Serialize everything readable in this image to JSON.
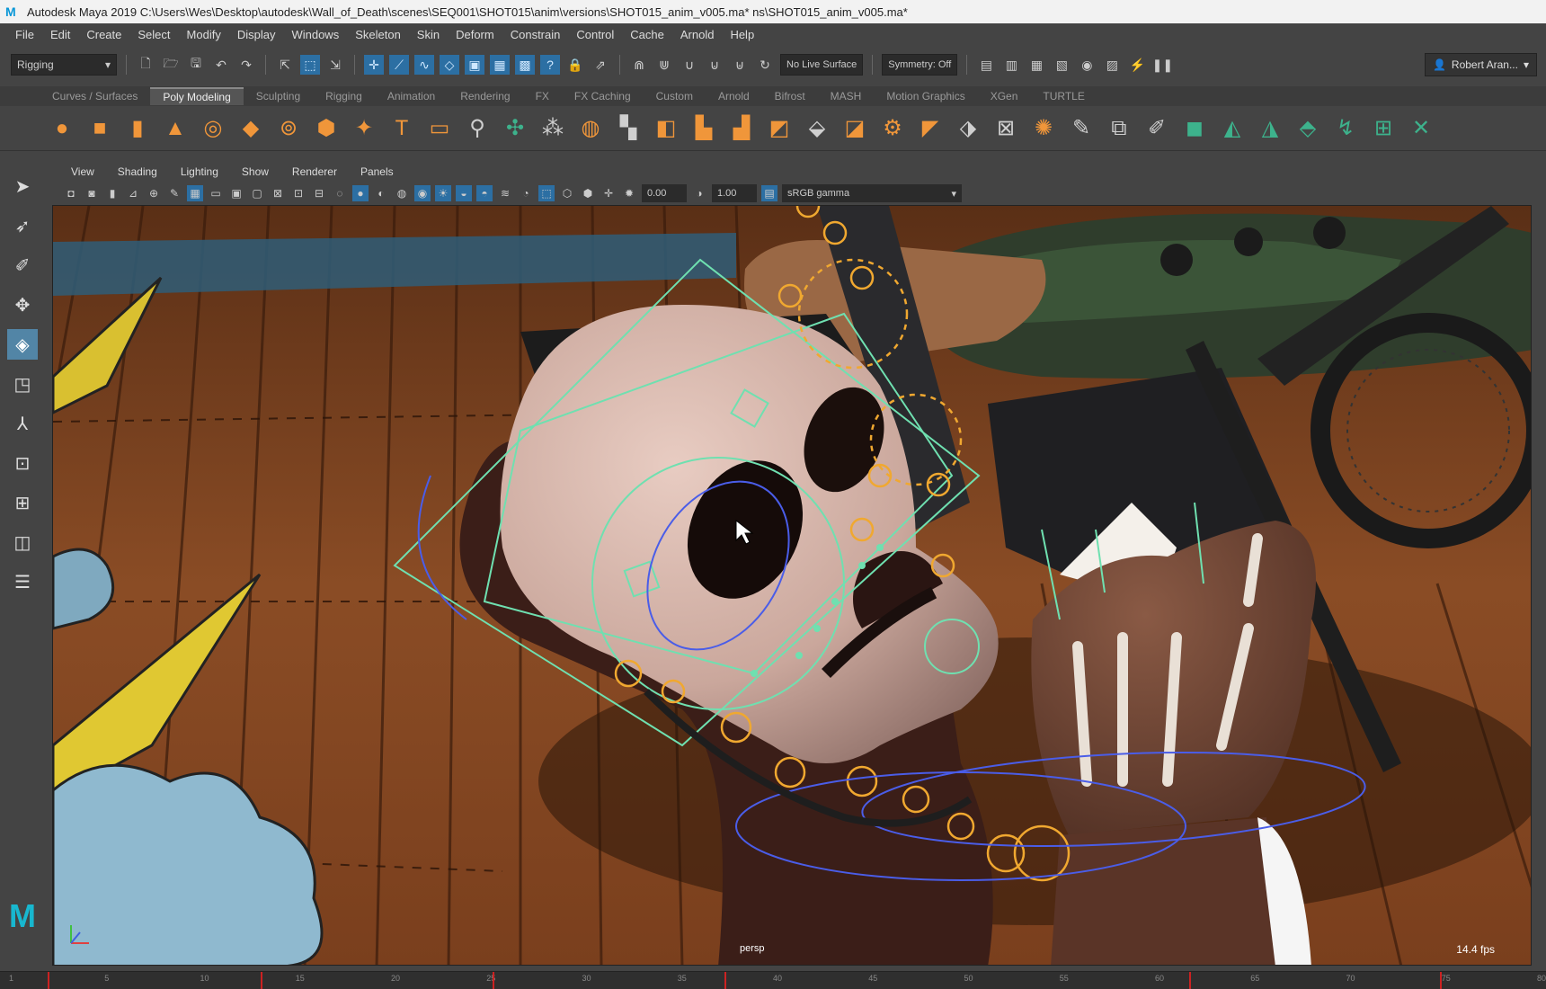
{
  "window": {
    "title": "Autodesk Maya 2019  C:\\Users\\Wes\\Desktop\\autodesk\\Wall_of_Death\\scenes\\SEQ001\\SHOT015\\anim\\versions\\SHOT015_anim_v005.ma*  ns\\SHOT015_anim_v005.ma*",
    "logo_icon": "maya-logo-icon"
  },
  "menubar": {
    "items": [
      "File",
      "Edit",
      "Create",
      "Select",
      "Modify",
      "Display",
      "Windows",
      "Skeleton",
      "Skin",
      "Deform",
      "Constrain",
      "Control",
      "Cache",
      "Arnold",
      "Help"
    ]
  },
  "statusline": {
    "mode": "Rigging",
    "live_surface": "No Live Surface",
    "symmetry": "Symmetry: Off",
    "user": "Robert Aran..."
  },
  "shelf": {
    "tabs": [
      "Curves / Surfaces",
      "Poly Modeling",
      "Sculpting",
      "Rigging",
      "Animation",
      "Rendering",
      "FX",
      "FX Caching",
      "Custom",
      "Arnold",
      "Bifrost",
      "MASH",
      "Motion Graphics",
      "XGen",
      "TURTLE"
    ],
    "active_tab": "Poly Modeling"
  },
  "panel": {
    "menus": [
      "View",
      "Shading",
      "Lighting",
      "Show",
      "Renderer",
      "Panels"
    ],
    "exposure": "0.00",
    "gamma": "1.00",
    "color_space": "sRGB gamma",
    "camera_label": "persp",
    "fps": "14.4 fps"
  },
  "timeline": {
    "ticks": [
      "1",
      "5",
      "10",
      "15",
      "20",
      "25",
      "30",
      "35",
      "40",
      "45",
      "50",
      "55",
      "60",
      "65",
      "70",
      "75",
      "80"
    ],
    "keys": [
      3,
      14,
      26,
      38,
      62,
      75,
      84
    ]
  },
  "colors": {
    "accent": "#5285a6",
    "rig_green": "#6fe0b0",
    "rig_orange": "#f0a830",
    "rig_blue": "#4a5de8",
    "floor": "#7a4322"
  }
}
